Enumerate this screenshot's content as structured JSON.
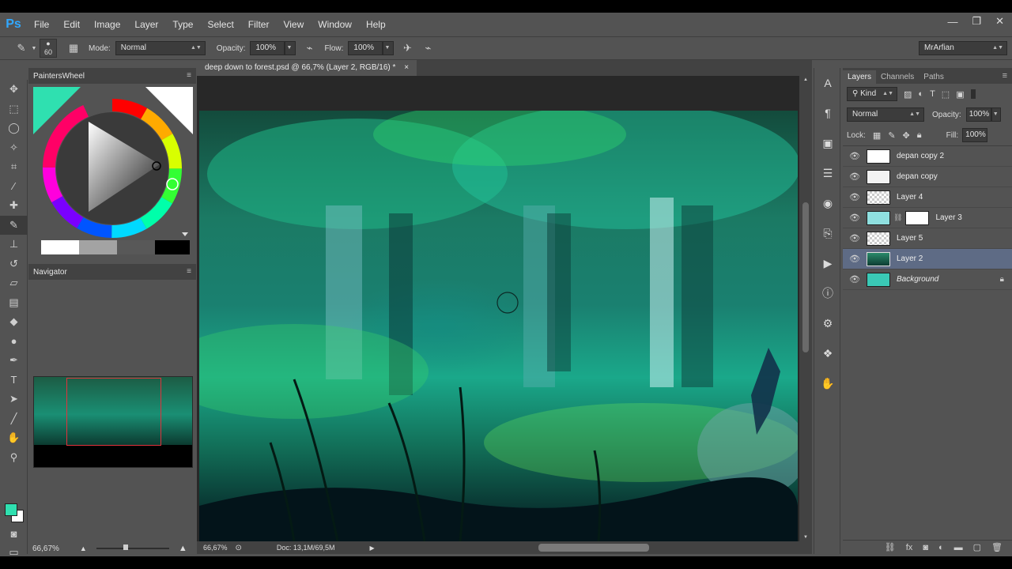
{
  "app": {
    "logo": "Ps"
  },
  "menu": [
    "File",
    "Edit",
    "Image",
    "Layer",
    "Type",
    "Select",
    "Filter",
    "View",
    "Window",
    "Help"
  ],
  "window_controls": {
    "minimize": "—",
    "restore": "❐",
    "close": "✕"
  },
  "options": {
    "brush_size": "60",
    "mode_label": "Mode:",
    "mode_value": "Normal",
    "opacity_label": "Opacity:",
    "opacity_value": "100%",
    "flow_label": "Flow:",
    "flow_value": "100%",
    "workspace": "MrArfian"
  },
  "panels": {
    "color_wheel_title": "PaintersWheel",
    "navigator_title": "Navigator",
    "nav_zoom": "66,67%"
  },
  "document": {
    "tab_title": "deep down to forest.psd @ 66,7% (Layer 2, RGB/16) *",
    "close_icon": "×",
    "zoom": "66,67%",
    "doc_size": "Doc: 13,1M/69,5M"
  },
  "layers_panel": {
    "tabs": [
      "Layers",
      "Channels",
      "Paths"
    ],
    "filter_label": "Kind",
    "blend_mode": "Normal",
    "opacity_label": "Opacity:",
    "opacity_value": "100%",
    "lock_label": "Lock:",
    "fill_label": "Fill:",
    "fill_value": "100%",
    "layers": [
      {
        "name": "depan copy 2",
        "selected": false
      },
      {
        "name": "depan copy",
        "selected": false
      },
      {
        "name": "Layer 4",
        "selected": false
      },
      {
        "name": "Layer 3",
        "selected": false
      },
      {
        "name": "Layer 5",
        "selected": false
      },
      {
        "name": "Layer 2",
        "selected": true
      },
      {
        "name": "Background",
        "selected": false
      }
    ]
  },
  "colors": {
    "foreground": "#2fe0b0",
    "background": "#ffffff",
    "selection_highlight": "#5e6b85",
    "navigator_rect": "#e0323c"
  }
}
